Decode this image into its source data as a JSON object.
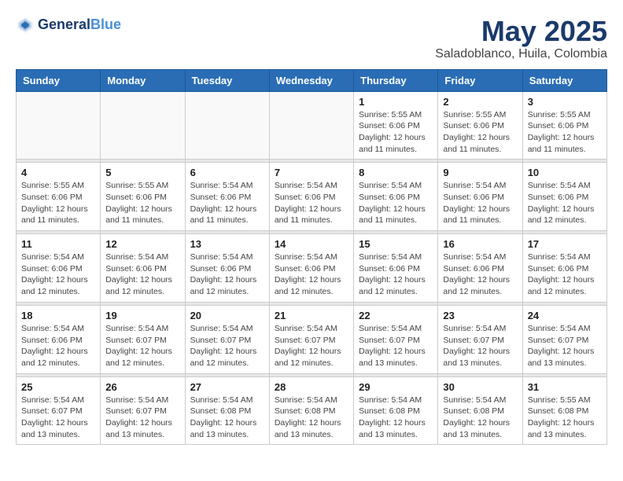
{
  "header": {
    "logo_line1": "General",
    "logo_line2": "Blue",
    "title": "May 2025",
    "subtitle": "Saladoblanco, Huila, Colombia"
  },
  "weekdays": [
    "Sunday",
    "Monday",
    "Tuesday",
    "Wednesday",
    "Thursday",
    "Friday",
    "Saturday"
  ],
  "weeks": [
    [
      {
        "day": "",
        "empty": true
      },
      {
        "day": "",
        "empty": true
      },
      {
        "day": "",
        "empty": true
      },
      {
        "day": "",
        "empty": true
      },
      {
        "day": "1",
        "sunrise": "5:55 AM",
        "sunset": "6:06 PM",
        "daylight": "12 hours and 11 minutes."
      },
      {
        "day": "2",
        "sunrise": "5:55 AM",
        "sunset": "6:06 PM",
        "daylight": "12 hours and 11 minutes."
      },
      {
        "day": "3",
        "sunrise": "5:55 AM",
        "sunset": "6:06 PM",
        "daylight": "12 hours and 11 minutes."
      }
    ],
    [
      {
        "day": "4",
        "sunrise": "5:55 AM",
        "sunset": "6:06 PM",
        "daylight": "12 hours and 11 minutes."
      },
      {
        "day": "5",
        "sunrise": "5:55 AM",
        "sunset": "6:06 PM",
        "daylight": "12 hours and 11 minutes."
      },
      {
        "day": "6",
        "sunrise": "5:54 AM",
        "sunset": "6:06 PM",
        "daylight": "12 hours and 11 minutes."
      },
      {
        "day": "7",
        "sunrise": "5:54 AM",
        "sunset": "6:06 PM",
        "daylight": "12 hours and 11 minutes."
      },
      {
        "day": "8",
        "sunrise": "5:54 AM",
        "sunset": "6:06 PM",
        "daylight": "12 hours and 11 minutes."
      },
      {
        "day": "9",
        "sunrise": "5:54 AM",
        "sunset": "6:06 PM",
        "daylight": "12 hours and 11 minutes."
      },
      {
        "day": "10",
        "sunrise": "5:54 AM",
        "sunset": "6:06 PM",
        "daylight": "12 hours and 12 minutes."
      }
    ],
    [
      {
        "day": "11",
        "sunrise": "5:54 AM",
        "sunset": "6:06 PM",
        "daylight": "12 hours and 12 minutes."
      },
      {
        "day": "12",
        "sunrise": "5:54 AM",
        "sunset": "6:06 PM",
        "daylight": "12 hours and 12 minutes."
      },
      {
        "day": "13",
        "sunrise": "5:54 AM",
        "sunset": "6:06 PM",
        "daylight": "12 hours and 12 minutes."
      },
      {
        "day": "14",
        "sunrise": "5:54 AM",
        "sunset": "6:06 PM",
        "daylight": "12 hours and 12 minutes."
      },
      {
        "day": "15",
        "sunrise": "5:54 AM",
        "sunset": "6:06 PM",
        "daylight": "12 hours and 12 minutes."
      },
      {
        "day": "16",
        "sunrise": "5:54 AM",
        "sunset": "6:06 PM",
        "daylight": "12 hours and 12 minutes."
      },
      {
        "day": "17",
        "sunrise": "5:54 AM",
        "sunset": "6:06 PM",
        "daylight": "12 hours and 12 minutes."
      }
    ],
    [
      {
        "day": "18",
        "sunrise": "5:54 AM",
        "sunset": "6:06 PM",
        "daylight": "12 hours and 12 minutes."
      },
      {
        "day": "19",
        "sunrise": "5:54 AM",
        "sunset": "6:07 PM",
        "daylight": "12 hours and 12 minutes."
      },
      {
        "day": "20",
        "sunrise": "5:54 AM",
        "sunset": "6:07 PM",
        "daylight": "12 hours and 12 minutes."
      },
      {
        "day": "21",
        "sunrise": "5:54 AM",
        "sunset": "6:07 PM",
        "daylight": "12 hours and 12 minutes."
      },
      {
        "day": "22",
        "sunrise": "5:54 AM",
        "sunset": "6:07 PM",
        "daylight": "12 hours and 13 minutes."
      },
      {
        "day": "23",
        "sunrise": "5:54 AM",
        "sunset": "6:07 PM",
        "daylight": "12 hours and 13 minutes."
      },
      {
        "day": "24",
        "sunrise": "5:54 AM",
        "sunset": "6:07 PM",
        "daylight": "12 hours and 13 minutes."
      }
    ],
    [
      {
        "day": "25",
        "sunrise": "5:54 AM",
        "sunset": "6:07 PM",
        "daylight": "12 hours and 13 minutes."
      },
      {
        "day": "26",
        "sunrise": "5:54 AM",
        "sunset": "6:07 PM",
        "daylight": "12 hours and 13 minutes."
      },
      {
        "day": "27",
        "sunrise": "5:54 AM",
        "sunset": "6:08 PM",
        "daylight": "12 hours and 13 minutes."
      },
      {
        "day": "28",
        "sunrise": "5:54 AM",
        "sunset": "6:08 PM",
        "daylight": "12 hours and 13 minutes."
      },
      {
        "day": "29",
        "sunrise": "5:54 AM",
        "sunset": "6:08 PM",
        "daylight": "12 hours and 13 minutes."
      },
      {
        "day": "30",
        "sunrise": "5:54 AM",
        "sunset": "6:08 PM",
        "daylight": "12 hours and 13 minutes."
      },
      {
        "day": "31",
        "sunrise": "5:55 AM",
        "sunset": "6:08 PM",
        "daylight": "12 hours and 13 minutes."
      }
    ]
  ]
}
